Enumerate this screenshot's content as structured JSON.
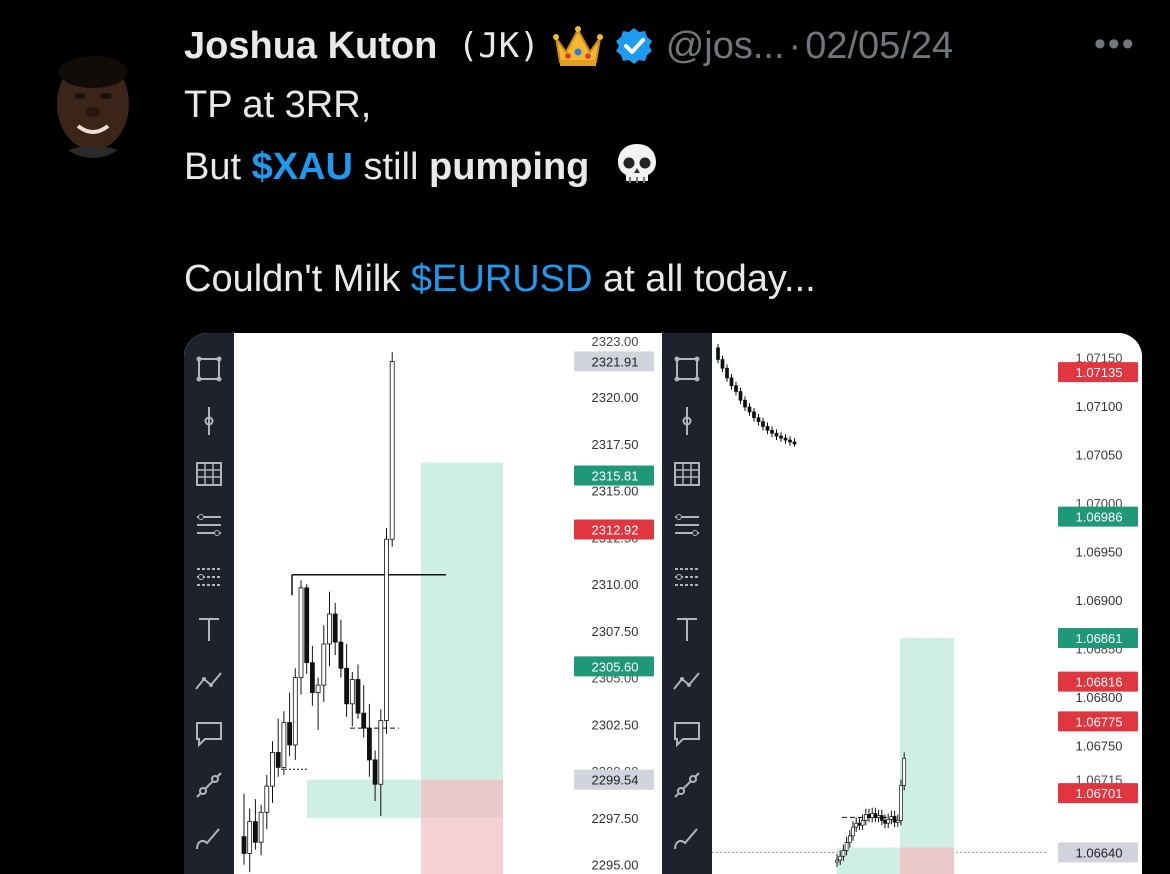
{
  "tweet": {
    "author_name": "Joshua Kuton",
    "author_suffix": "(JK)",
    "handle": "@jos...",
    "separator": "·",
    "date": "02/05/24",
    "more_glyph": "•••",
    "line1": "TP at 3RR,",
    "line2_pre": "But ",
    "line2_tag": "$XAU",
    "line2_mid": " still ",
    "line2_bold": "pumping",
    "line3_pre": "Couldn't Milk ",
    "line3_tag": "$EURUSD",
    "line3_post": " at all today...",
    "icons": [
      "avatar",
      "crown-icon",
      "verified-badge-icon",
      "skull-icon",
      "more-options-icon"
    ]
  },
  "colors": {
    "background": "#000000",
    "text": "#e7e9ea",
    "muted": "#71767b",
    "link": "#1d9bf0",
    "verified": "#1d9bf0",
    "profit_zone": "#cfeee4",
    "loss_zone": "#f6d2d4",
    "green_label": "#1e9878",
    "red_label": "#e0363f",
    "toolbar": "#1e222d"
  },
  "toolbar_tools": [
    "crosshair-tool-icon",
    "cursor-line-tool-icon",
    "grid-tool-icon",
    "fib-tool-icon",
    "pitchfork-tool-icon",
    "text-tool-icon",
    "trend-tool-icon",
    "comment-tool-icon",
    "measure-tool-icon",
    "brush-tool-icon",
    "more-tool-icon"
  ],
  "xau_chart": {
    "price_labels": [
      "2320.00",
      "2317.50",
      "2315.00",
      "2310.00",
      "2307.50",
      "2302.50",
      "2297.50",
      "2295.00"
    ],
    "price_values": [
      2320.0,
      2317.5,
      2315.0,
      2310.0,
      2307.5,
      2302.5,
      2297.5,
      2295.0
    ],
    "top_partial": "2323.00",
    "cut_labels": [
      "2312.50",
      "2305.00",
      "2300.00"
    ],
    "markers": [
      {
        "text": "2321.91",
        "style": "gray"
      },
      {
        "text": "2315.81",
        "style": "green"
      },
      {
        "text": "2312.92",
        "style": "red"
      },
      {
        "text": "2305.60",
        "style": "green"
      },
      {
        "text": "2299.54",
        "style": "gray"
      }
    ],
    "marker_values": [
      2321.91,
      2315.81,
      2312.92,
      2305.6,
      2299.54
    ]
  },
  "eurusd_chart": {
    "price_labels": [
      "1.07100",
      "1.07050",
      "1.06950",
      "1.06900",
      "1.06800",
      "1.06750"
    ],
    "price_values": [
      1.071,
      1.0705,
      1.0695,
      1.069,
      1.068,
      1.0675
    ],
    "cut_labels": [
      "1.07150",
      "1.07000",
      "1.06850",
      "1.06715"
    ],
    "markers": [
      {
        "text": "1.07135",
        "style": "red"
      },
      {
        "text": "1.06986",
        "style": "green"
      },
      {
        "text": "1.06861",
        "style": "green"
      },
      {
        "text": "1.06816",
        "style": "red"
      },
      {
        "text": "1.06775",
        "style": "red"
      },
      {
        "text": "1.06701",
        "style": "red"
      },
      {
        "text": "1.06640",
        "style": "gray"
      }
    ],
    "marker_values": [
      1.07135,
      1.06986,
      1.06861,
      1.06816,
      1.06775,
      1.06701,
      1.0664
    ]
  }
}
